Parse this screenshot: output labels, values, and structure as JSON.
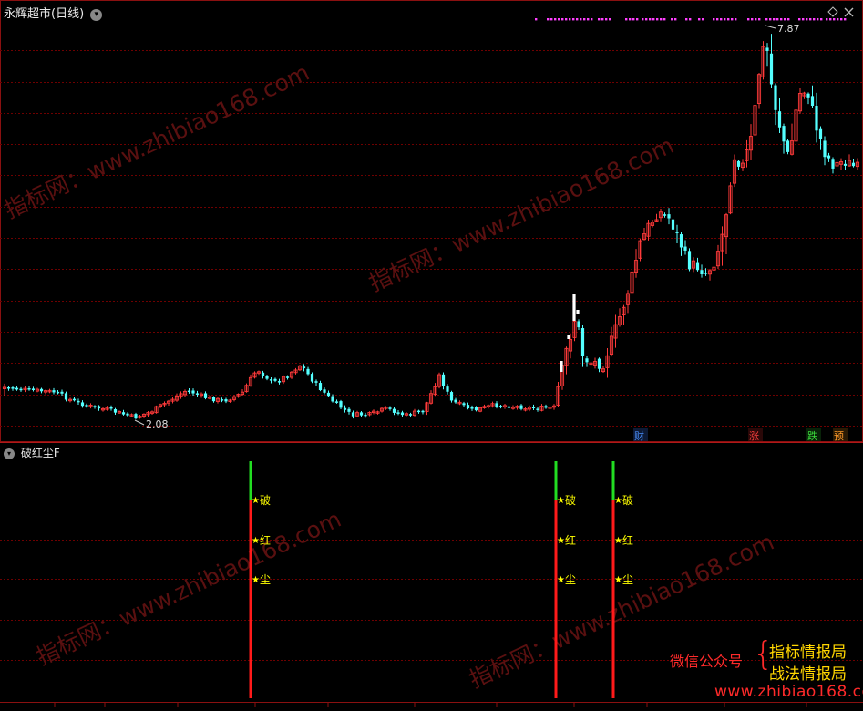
{
  "main_panel": {
    "title": "永辉超市(日线)",
    "high_label": "7.87",
    "low_label": "2.08",
    "event_tags": [
      {
        "text": "财",
        "color": "#4a90ff"
      },
      {
        "text": "涨",
        "color": "#ff4040"
      },
      {
        "text": "跌",
        "color": "#3cdc3c"
      },
      {
        "text": "预",
        "color": "#ff9a2a"
      }
    ]
  },
  "indicator_panel": {
    "title": "破红尘F",
    "signal_chars": [
      "破",
      "红",
      "尘"
    ],
    "signal_count": 3
  },
  "watermark": {
    "text": "指标网：www.zhibiao168.com",
    "url": "www.zhibiao168.com"
  },
  "promo": {
    "wechat_label": "微信公众号",
    "brace": "{",
    "line1": "指标情报局",
    "line2": "战法情报局"
  },
  "colors": {
    "up_candle": "#ff3a3a",
    "down_candle": "#54ffff",
    "grid": "#6e0000",
    "frame": "#8a1010",
    "signal_red": "#ff1a1a",
    "signal_green": "#22dd22",
    "signal_text": "#ffff00",
    "magenta_dots": "#ff40ff"
  },
  "icons": [
    "chevron-down-icon",
    "diamond-icon",
    "close-icon",
    "star-icon"
  ]
}
